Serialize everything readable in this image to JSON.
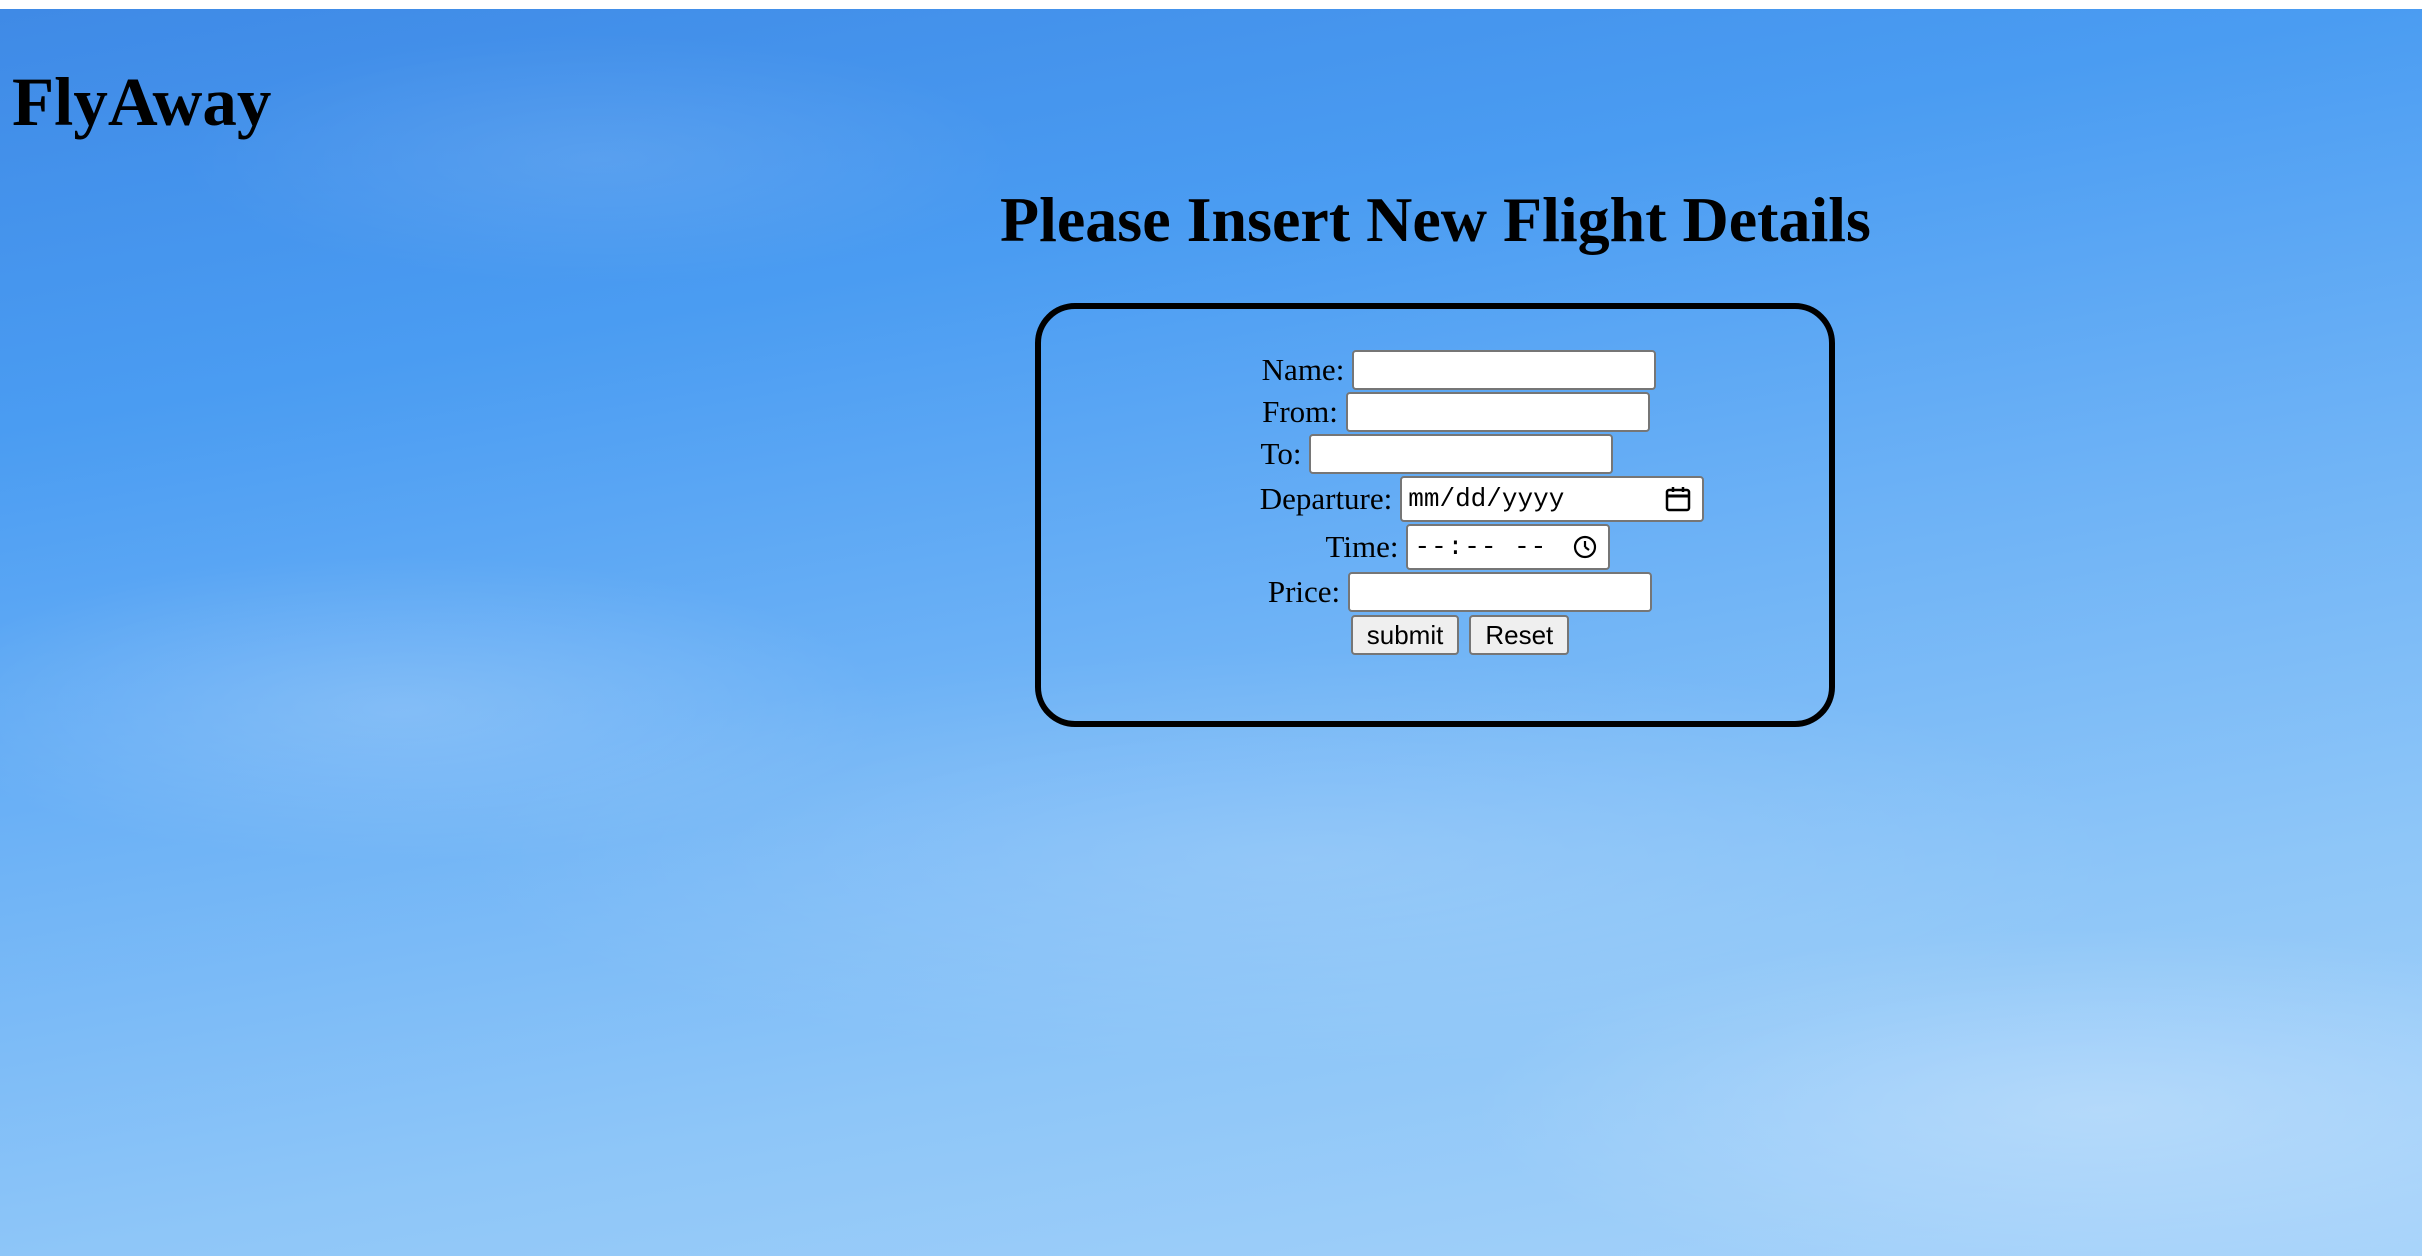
{
  "header": {
    "brand": "FlyAway"
  },
  "main": {
    "title": "Please Insert New Flight Details"
  },
  "form": {
    "name_label": "Name:",
    "name_value": "",
    "from_label": "From:",
    "from_value": "",
    "to_label": "To:",
    "to_value": "",
    "departure_label": "Departure:",
    "departure_placeholder": "mm/dd/yyyy",
    "time_label": "Time:",
    "time_placeholder": "--:-- --",
    "price_label": "Price:",
    "price_value": "",
    "submit_label": "submit",
    "reset_label": "Reset",
    "calendar_icon": "calendar-icon",
    "clock_icon": "clock-icon"
  }
}
